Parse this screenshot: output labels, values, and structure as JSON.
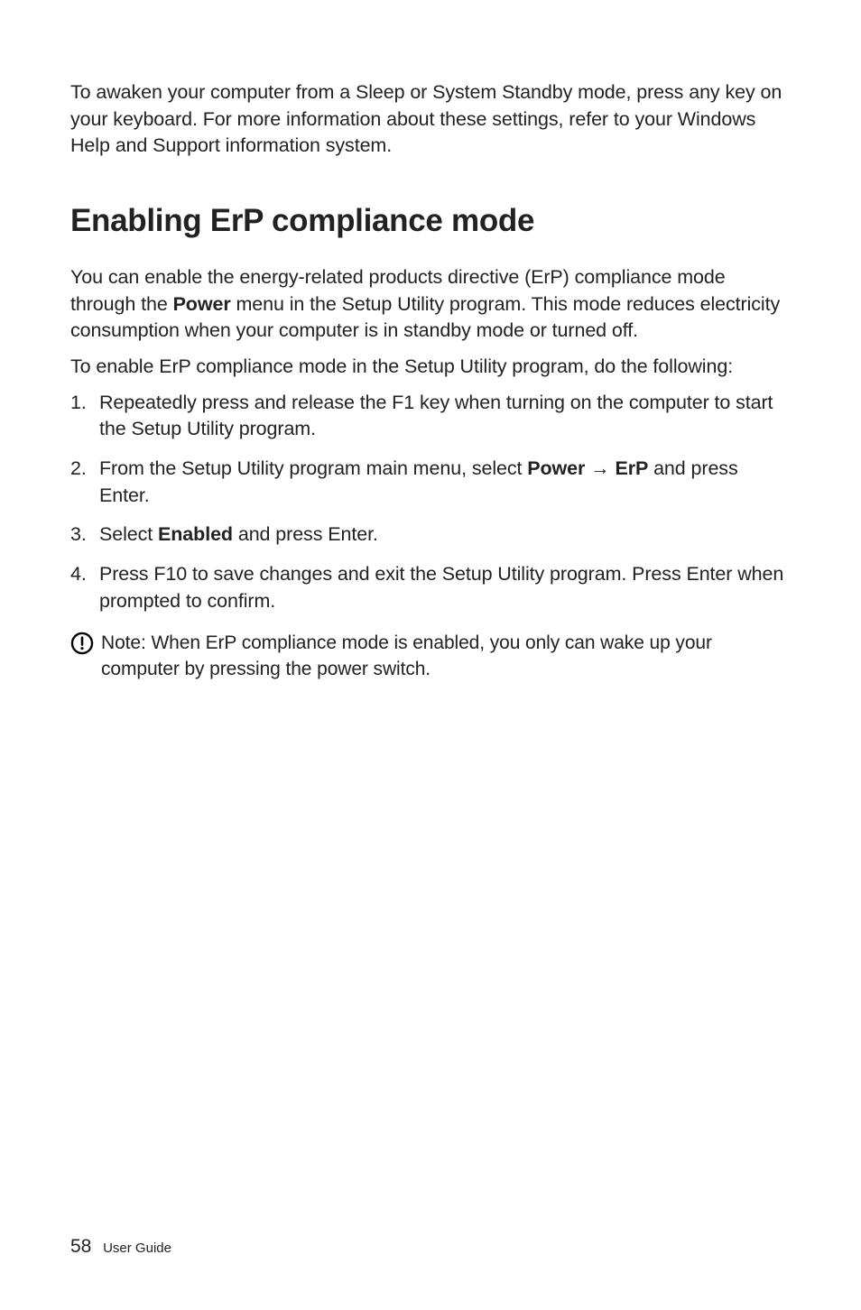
{
  "intro": "To awaken your computer from a Sleep or System Standby mode, press any key on your keyboard. For more information about these settings, refer to your Windows Help and Support information system.",
  "heading": "Enabling ErP compliance mode",
  "p1_pre": "You can enable the energy-related products directive (ErP) compliance mode through the ",
  "p1_bold": "Power",
  "p1_post": " menu in the Setup Utility program. This mode reduces electricity consumption when your computer is in standby mode or turned off.",
  "p2": "To enable ErP compliance mode in the Setup Utility program, do the following:",
  "steps": {
    "s1": "Repeatedly press and release the F1 key when turning on the computer to start the Setup Utility program.",
    "s2_pre": "From the Setup Utility program main menu, select ",
    "s2_b1": "Power",
    "s2_arrow": " → ",
    "s2_b2": "ErP",
    "s2_post": " and press Enter.",
    "s3_pre": "Select ",
    "s3_b": "Enabled",
    "s3_post": " and press Enter.",
    "s4": "Press F10 to save changes and exit the Setup Utility program. Press Enter when prompted to confirm."
  },
  "note_label": "Note:",
  "note_body": " When ErP compliance mode is enabled, you only can wake up your computer by pressing the power switch.",
  "footer": {
    "page": "58",
    "title": "User Guide"
  }
}
